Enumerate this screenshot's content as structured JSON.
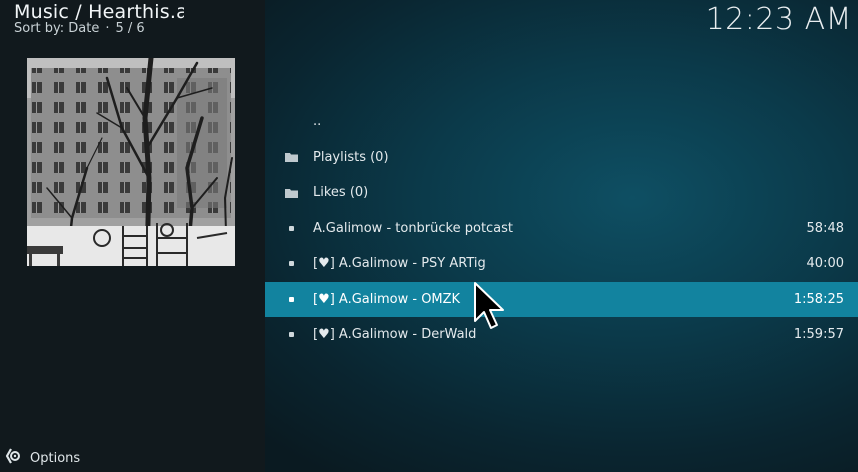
{
  "header": {
    "title": "Music / Hearthis.at",
    "sort_label": "Sort by: Date",
    "separator": "·",
    "position": "5 / 6"
  },
  "clock": "12:23 AM",
  "list": {
    "items": [
      {
        "label": "..",
        "duration": "",
        "icon": "none",
        "selected": false
      },
      {
        "label": "Playlists (0)",
        "duration": "",
        "icon": "folder-icon",
        "selected": false
      },
      {
        "label": "Likes (0)",
        "duration": "",
        "icon": "folder-icon",
        "selected": false
      },
      {
        "label": "A.Galimow - tonbrücke potcast",
        "duration": "58:48",
        "icon": "bullet-icon",
        "selected": false
      },
      {
        "label": "[♥] A.Galimow - PSY ARTig",
        "duration": "40:00",
        "icon": "bullet-icon",
        "selected": false
      },
      {
        "label": "[♥] A.Galimow - OMZK",
        "duration": "1:58:25",
        "icon": "bullet-icon",
        "selected": true
      },
      {
        "label": "[♥] A.Galimow - DerWald",
        "duration": "1:59:57",
        "icon": "bullet-icon",
        "selected": false
      }
    ]
  },
  "footer": {
    "options_label": "Options",
    "options_icon": "options-gear-icon"
  },
  "colors": {
    "selected_row": "#12839f",
    "left_panel": "#11191d",
    "background_center": "#0e4f63"
  }
}
